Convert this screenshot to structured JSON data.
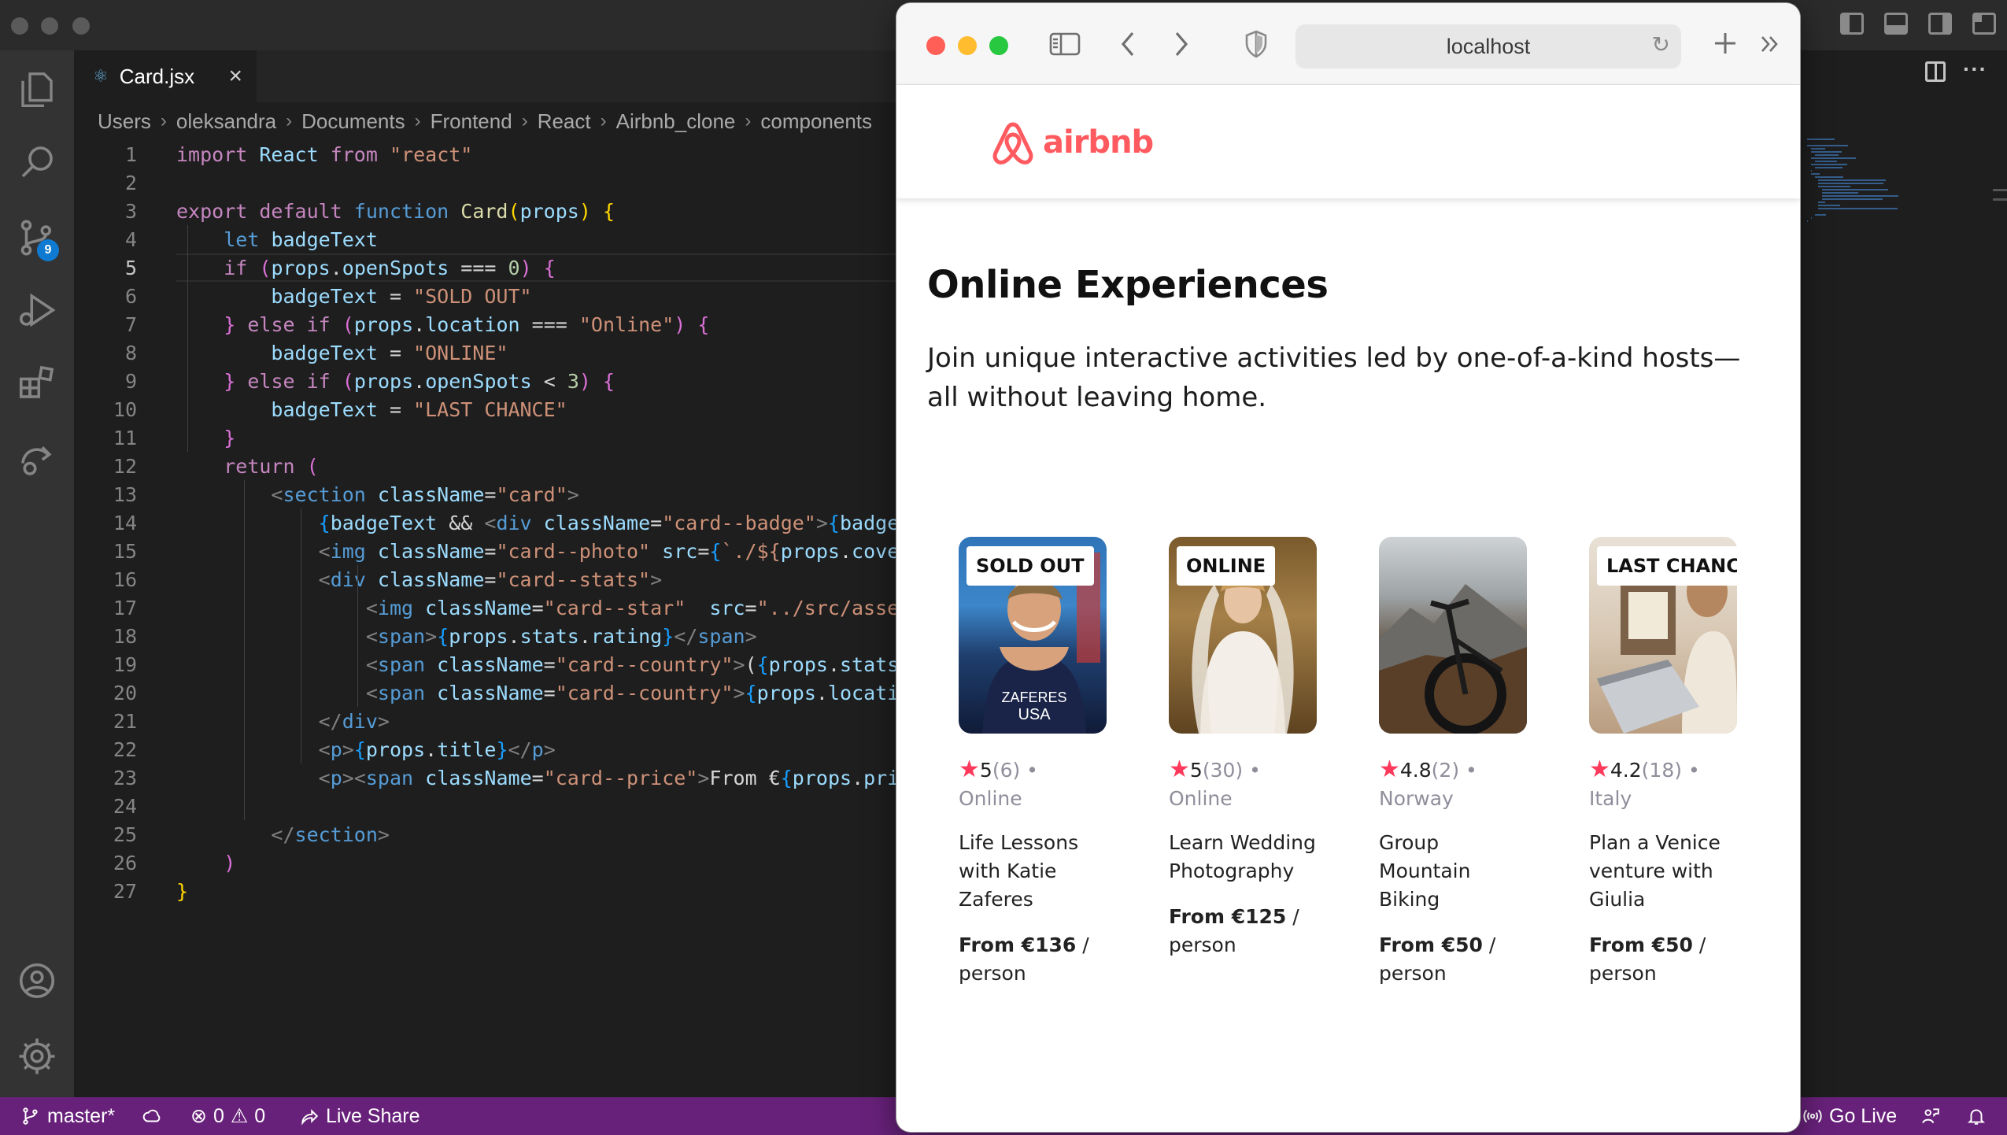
{
  "vscode": {
    "tab": {
      "label": "Card.jsx",
      "close": "×"
    },
    "breadcrumb": [
      "Users",
      "oleksandra",
      "Documents",
      "Frontend",
      "React",
      "Airbnb_clone",
      "components"
    ],
    "scm_badge": "9",
    "line_numbers": [
      "1",
      "2",
      "3",
      "4",
      "5",
      "6",
      "7",
      "8",
      "9",
      "10",
      "11",
      "12",
      "13",
      "14",
      "15",
      "16",
      "17",
      "18",
      "19",
      "20",
      "21",
      "22",
      "23",
      "24",
      "25",
      "26",
      "27"
    ],
    "status": {
      "branch": "master*",
      "errors": "0",
      "warnings": "0",
      "live_share": "Live Share",
      "go_live": "Go Live"
    }
  },
  "safari": {
    "address": "localhost",
    "brand": "airbnb",
    "brand_color": "#ff5a5f"
  },
  "page": {
    "title": "Online Experiences",
    "subtitle": "Join unique interactive activities led by one-of-a-kind hosts—all without leaving home.",
    "cards": [
      {
        "badge": "SOLD OUT",
        "rating": "5",
        "reviews": "(6)",
        "location": "Online",
        "title": "Life Lessons with Katie Zaferes",
        "price_label": "From €136",
        "price_unit": "/ person",
        "photo_text": "ZAFERES\nUSA"
      },
      {
        "badge": "ONLINE",
        "rating": "5",
        "reviews": "(30)",
        "location": "Online",
        "title": "Learn Wedding Photography",
        "price_label": "From €125",
        "price_unit": "/ person"
      },
      {
        "badge": "",
        "rating": "4.8",
        "reviews": "(2)",
        "location": "Norway",
        "title": "Group Mountain Biking",
        "price_label": "From €50",
        "price_unit": "/ person"
      },
      {
        "badge": "LAST CHANCE",
        "rating": "4.2",
        "reviews": "(18)",
        "location": "Italy",
        "title": "Plan a Venice venture with Giulia",
        "price_label": "From €50",
        "price_unit": "/ person"
      }
    ]
  },
  "code_lines": [
    [
      [
        "k",
        "import"
      ],
      [
        "w",
        " "
      ],
      [
        "v",
        "React"
      ],
      [
        "w",
        " "
      ],
      [
        "k",
        "from"
      ],
      [
        "w",
        " "
      ],
      [
        "s",
        "\"react\""
      ]
    ],
    [],
    [
      [
        "k",
        "export"
      ],
      [
        "w",
        " "
      ],
      [
        "k",
        "default"
      ],
      [
        "w",
        " "
      ],
      [
        "kb",
        "function"
      ],
      [
        "w",
        " "
      ],
      [
        "f",
        "Card"
      ],
      [
        "br",
        "("
      ],
      [
        "v",
        "props"
      ],
      [
        "br",
        ")"
      ],
      [
        "w",
        " "
      ],
      [
        "br",
        "{"
      ]
    ],
    [
      [
        "w",
        "    "
      ],
      [
        "kb",
        "let"
      ],
      [
        "w",
        " "
      ],
      [
        "v",
        "badgeText"
      ]
    ],
    [
      [
        "w",
        "    "
      ],
      [
        "k",
        "if"
      ],
      [
        "w",
        " "
      ],
      [
        "br2",
        "("
      ],
      [
        "v",
        "props"
      ],
      [
        "w",
        "."
      ],
      [
        "v",
        "openSpots"
      ],
      [
        "w",
        " === "
      ],
      [
        "n",
        "0"
      ],
      [
        "br2",
        ")"
      ],
      [
        "w",
        " "
      ],
      [
        "br2",
        "{"
      ]
    ],
    [
      [
        "w",
        "        "
      ],
      [
        "v",
        "badgeText"
      ],
      [
        "w",
        " = "
      ],
      [
        "s",
        "\"SOLD OUT\""
      ]
    ],
    [
      [
        "w",
        "    "
      ],
      [
        "br2",
        "}"
      ],
      [
        "w",
        " "
      ],
      [
        "k",
        "else"
      ],
      [
        "w",
        " "
      ],
      [
        "k",
        "if"
      ],
      [
        "w",
        " "
      ],
      [
        "br2",
        "("
      ],
      [
        "v",
        "props"
      ],
      [
        "w",
        "."
      ],
      [
        "v",
        "location"
      ],
      [
        "w",
        " === "
      ],
      [
        "s",
        "\"Online\""
      ],
      [
        "br2",
        ")"
      ],
      [
        "w",
        " "
      ],
      [
        "br2",
        "{"
      ]
    ],
    [
      [
        "w",
        "        "
      ],
      [
        "v",
        "badgeText"
      ],
      [
        "w",
        " = "
      ],
      [
        "s",
        "\"ONLINE\""
      ]
    ],
    [
      [
        "w",
        "    "
      ],
      [
        "br2",
        "}"
      ],
      [
        "w",
        " "
      ],
      [
        "k",
        "else"
      ],
      [
        "w",
        " "
      ],
      [
        "k",
        "if"
      ],
      [
        "w",
        " "
      ],
      [
        "br2",
        "("
      ],
      [
        "v",
        "props"
      ],
      [
        "w",
        "."
      ],
      [
        "v",
        "openSpots"
      ],
      [
        "w",
        " < "
      ],
      [
        "n",
        "3"
      ],
      [
        "br2",
        ")"
      ],
      [
        "w",
        " "
      ],
      [
        "br2",
        "{"
      ]
    ],
    [
      [
        "w",
        "        "
      ],
      [
        "v",
        "badgeText"
      ],
      [
        "w",
        " = "
      ],
      [
        "s",
        "\"LAST CHANCE\""
      ]
    ],
    [
      [
        "w",
        "    "
      ],
      [
        "br2",
        "}"
      ]
    ],
    [
      [
        "w",
        "    "
      ],
      [
        "k",
        "return"
      ],
      [
        "w",
        " "
      ],
      [
        "br2",
        "("
      ]
    ],
    [
      [
        "w",
        "        "
      ],
      [
        "p",
        "<"
      ],
      [
        "t",
        "section"
      ],
      [
        "w",
        " "
      ],
      [
        "a",
        "className"
      ],
      [
        "w",
        "="
      ],
      [
        "s",
        "\"card\""
      ],
      [
        "p",
        ">"
      ]
    ],
    [
      [
        "w",
        "            "
      ],
      [
        "br3",
        "{"
      ],
      [
        "v",
        "badgeText"
      ],
      [
        "w",
        " && "
      ],
      [
        "p",
        "<"
      ],
      [
        "t",
        "div"
      ],
      [
        "w",
        " "
      ],
      [
        "a",
        "className"
      ],
      [
        "w",
        "="
      ],
      [
        "s",
        "\"card--badge\""
      ],
      [
        "p",
        ">"
      ],
      [
        "br3",
        "{"
      ],
      [
        "v",
        "badgeText"
      ],
      [
        "br3",
        "}"
      ],
      [
        "p",
        "</"
      ],
      [
        "t",
        "div"
      ],
      [
        "p",
        ">"
      ],
      [
        "br3",
        "}"
      ]
    ],
    [
      [
        "w",
        "            "
      ],
      [
        "p",
        "<"
      ],
      [
        "t",
        "img"
      ],
      [
        "w",
        " "
      ],
      [
        "a",
        "className"
      ],
      [
        "w",
        "="
      ],
      [
        "s",
        "\"card--photo\""
      ],
      [
        "w",
        " "
      ],
      [
        "a",
        "src"
      ],
      [
        "w",
        "="
      ],
      [
        "br3",
        "{"
      ],
      [
        "s",
        "`./${"
      ],
      [
        "v",
        "props"
      ],
      [
        "w",
        "."
      ],
      [
        "v",
        "coverImg"
      ],
      [
        "s",
        "}`"
      ],
      [
        "br3",
        "}"
      ],
      [
        "w",
        " "
      ],
      [
        "p",
        "/>"
      ]
    ],
    [
      [
        "w",
        "            "
      ],
      [
        "p",
        "<"
      ],
      [
        "t",
        "div"
      ],
      [
        "w",
        " "
      ],
      [
        "a",
        "className"
      ],
      [
        "w",
        "="
      ],
      [
        "s",
        "\"card--stats\""
      ],
      [
        "p",
        ">"
      ]
    ],
    [
      [
        "w",
        "                "
      ],
      [
        "p",
        "<"
      ],
      [
        "t",
        "img"
      ],
      [
        "w",
        " "
      ],
      [
        "a",
        "className"
      ],
      [
        "w",
        "="
      ],
      [
        "s",
        "\"card--star\""
      ],
      [
        "w",
        "  "
      ],
      [
        "a",
        "src"
      ],
      [
        "w",
        "="
      ],
      [
        "s",
        "\"../src/assets/star.png\""
      ],
      [
        "w",
        " "
      ],
      [
        "p",
        "/>"
      ]
    ],
    [
      [
        "w",
        "                "
      ],
      [
        "p",
        "<"
      ],
      [
        "t",
        "span"
      ],
      [
        "p",
        ">"
      ],
      [
        "br3",
        "{"
      ],
      [
        "v",
        "props"
      ],
      [
        "w",
        "."
      ],
      [
        "v",
        "stats"
      ],
      [
        "w",
        "."
      ],
      [
        "v",
        "rating"
      ],
      [
        "br3",
        "}"
      ],
      [
        "p",
        "</"
      ],
      [
        "t",
        "span"
      ],
      [
        "p",
        ">"
      ]
    ],
    [
      [
        "w",
        "                "
      ],
      [
        "p",
        "<"
      ],
      [
        "t",
        "span"
      ],
      [
        "w",
        " "
      ],
      [
        "a",
        "className"
      ],
      [
        "w",
        "="
      ],
      [
        "s",
        "\"card--country\""
      ],
      [
        "p",
        ">"
      ],
      [
        "w",
        "("
      ],
      [
        "br3",
        "{"
      ],
      [
        "v",
        "props"
      ],
      [
        "w",
        "."
      ],
      [
        "v",
        "stats"
      ],
      [
        "w",
        "."
      ],
      [
        "v",
        "reviewCount"
      ],
      [
        "br3",
        "}"
      ],
      [
        "w",
        ") • "
      ],
      [
        "p",
        "</"
      ],
      [
        "t",
        "span"
      ],
      [
        "p",
        ">"
      ]
    ],
    [
      [
        "w",
        "                "
      ],
      [
        "p",
        "<"
      ],
      [
        "t",
        "span"
      ],
      [
        "w",
        " "
      ],
      [
        "a",
        "className"
      ],
      [
        "w",
        "="
      ],
      [
        "s",
        "\"card--country\""
      ],
      [
        "p",
        ">"
      ],
      [
        "br3",
        "{"
      ],
      [
        "v",
        "props"
      ],
      [
        "w",
        "."
      ],
      [
        "v",
        "location"
      ],
      [
        "br3",
        "}"
      ],
      [
        "p",
        "</"
      ],
      [
        "t",
        "span"
      ],
      [
        "p",
        ">"
      ]
    ],
    [
      [
        "w",
        "            "
      ],
      [
        "p",
        "</"
      ],
      [
        "t",
        "div"
      ],
      [
        "p",
        ">"
      ]
    ],
    [
      [
        "w",
        "            "
      ],
      [
        "p",
        "<"
      ],
      [
        "t",
        "p"
      ],
      [
        "p",
        ">"
      ],
      [
        "br3",
        "{"
      ],
      [
        "v",
        "props"
      ],
      [
        "w",
        "."
      ],
      [
        "v",
        "title"
      ],
      [
        "br3",
        "}"
      ],
      [
        "p",
        "</"
      ],
      [
        "t",
        "p"
      ],
      [
        "p",
        ">"
      ]
    ],
    [
      [
        "w",
        "            "
      ],
      [
        "p",
        "<"
      ],
      [
        "t",
        "p"
      ],
      [
        "p",
        ">"
      ],
      [
        "p",
        "<"
      ],
      [
        "t",
        "span"
      ],
      [
        "w",
        " "
      ],
      [
        "a",
        "className"
      ],
      [
        "w",
        "="
      ],
      [
        "s",
        "\"card--price\""
      ],
      [
        "p",
        ">"
      ],
      [
        "w",
        "From €"
      ],
      [
        "br3",
        "{"
      ],
      [
        "v",
        "props"
      ],
      [
        "w",
        "."
      ],
      [
        "v",
        "price"
      ],
      [
        "br3",
        "}"
      ],
      [
        "p",
        "</"
      ],
      [
        "t",
        "span"
      ],
      [
        "p",
        ">"
      ],
      [
        "w",
        " / person"
      ],
      [
        "p",
        "</"
      ],
      [
        "t",
        "p"
      ],
      [
        "p",
        ">"
      ]
    ],
    [],
    [
      [
        "w",
        "        "
      ],
      [
        "p",
        "</"
      ],
      [
        "t",
        "section"
      ],
      [
        "p",
        ">"
      ]
    ],
    [
      [
        "w",
        "    "
      ],
      [
        "br2",
        ")"
      ]
    ],
    [
      [
        "br",
        "}"
      ]
    ]
  ]
}
